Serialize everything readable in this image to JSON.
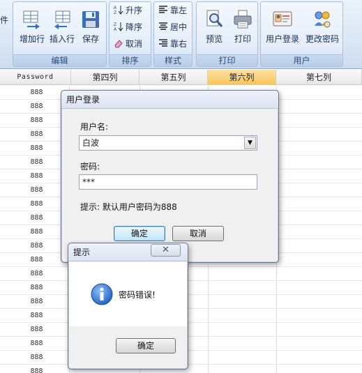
{
  "ribbon": {
    "left_fragment": "件",
    "edit": {
      "label": "编辑",
      "buttons": [
        "增加行",
        "插入行",
        "保存"
      ]
    },
    "sort": {
      "label": "排序",
      "buttons": [
        "升序",
        "降序",
        "取消"
      ]
    },
    "style": {
      "label": "样式",
      "buttons": [
        "靠左",
        "居中",
        "靠右"
      ]
    },
    "print": {
      "label": "打印",
      "buttons": [
        "预览",
        "打印"
      ]
    },
    "user": {
      "label": "用户",
      "buttons": [
        "用户登录",
        "更改密码"
      ]
    }
  },
  "grid": {
    "columns": [
      "Password",
      "第四列",
      "第五列",
      "第六列",
      "第七列"
    ],
    "selected_column": "第六列",
    "password_values": [
      "888",
      "888",
      "888",
      "888",
      "888",
      "888",
      "888",
      "888",
      "888",
      "888",
      "888",
      "888",
      "888",
      "888",
      "888",
      "888",
      "888",
      "888",
      "888",
      "888",
      "888"
    ]
  },
  "login_dialog": {
    "title": "用户登录",
    "username_label": "用户名:",
    "username_value": "白波",
    "password_label": "密码:",
    "password_value": "***",
    "hint": "提示: 默认用户密码为888",
    "ok_label": "确定",
    "cancel_label": "取消"
  },
  "message_box": {
    "title": "提示",
    "close_glyph": "✕",
    "message": "密码错误!",
    "ok_label": "确定",
    "icon": "info-icon"
  },
  "colors": {
    "selected_header": "#f9c55a",
    "ribbon_text": "#1b2f52",
    "info_blue": "#1d5fb8"
  }
}
